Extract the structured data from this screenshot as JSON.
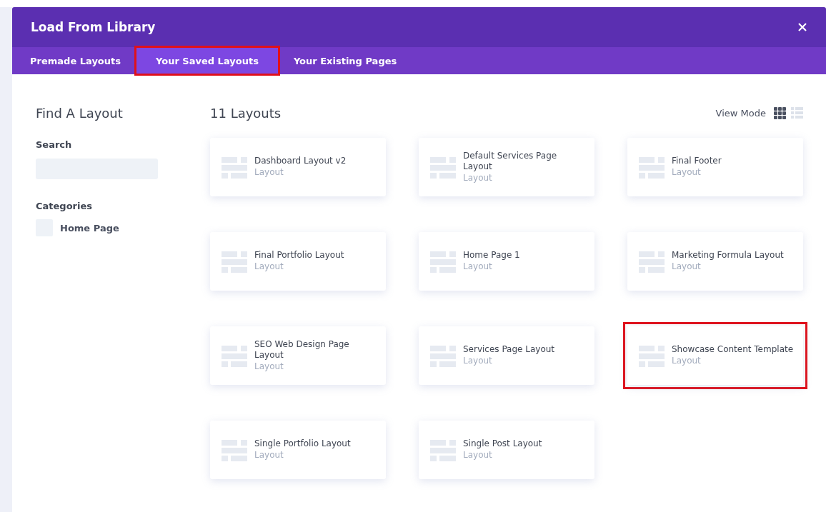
{
  "window": {
    "title": "Load From Library"
  },
  "tabs": [
    {
      "label": "Premade Layouts",
      "selected": false,
      "highlighted": false
    },
    {
      "label": "Your Saved Layouts",
      "selected": true,
      "highlighted": true
    },
    {
      "label": "Your Existing Pages",
      "selected": false,
      "highlighted": false
    }
  ],
  "sidebar": {
    "heading": "Find A Layout",
    "search_label": "Search",
    "categories_label": "Categories",
    "categories": [
      {
        "label": "Home Page",
        "checked": false
      }
    ]
  },
  "main": {
    "count": "11 Layouts",
    "view_mode_label": "View Mode",
    "view_modes": [
      {
        "kind": "grid",
        "selected": true
      },
      {
        "kind": "list",
        "selected": false
      }
    ],
    "layouts": [
      {
        "title": "Dashboard Layout v2",
        "type": "Layout",
        "highlighted": false
      },
      {
        "title": "Default Services Page Layout",
        "type": "Layout",
        "highlighted": false
      },
      {
        "title": "Final Footer",
        "type": "Layout",
        "highlighted": false
      },
      {
        "title": "Final Portfolio Layout",
        "type": "Layout",
        "highlighted": false
      },
      {
        "title": "Home Page 1",
        "type": "Layout",
        "highlighted": false
      },
      {
        "title": "Marketing Formula Layout",
        "type": "Layout",
        "highlighted": false
      },
      {
        "title": "SEO Web Design Page Layout",
        "type": "Layout",
        "highlighted": false
      },
      {
        "title": "Services Page Layout",
        "type": "Layout",
        "highlighted": false
      },
      {
        "title": "Showcase Content Template",
        "type": "Layout",
        "highlighted": true
      },
      {
        "title": "Single Portfolio Layout",
        "type": "Layout",
        "highlighted": false
      },
      {
        "title": "Single Post Layout",
        "type": "Layout",
        "highlighted": false
      }
    ]
  }
}
